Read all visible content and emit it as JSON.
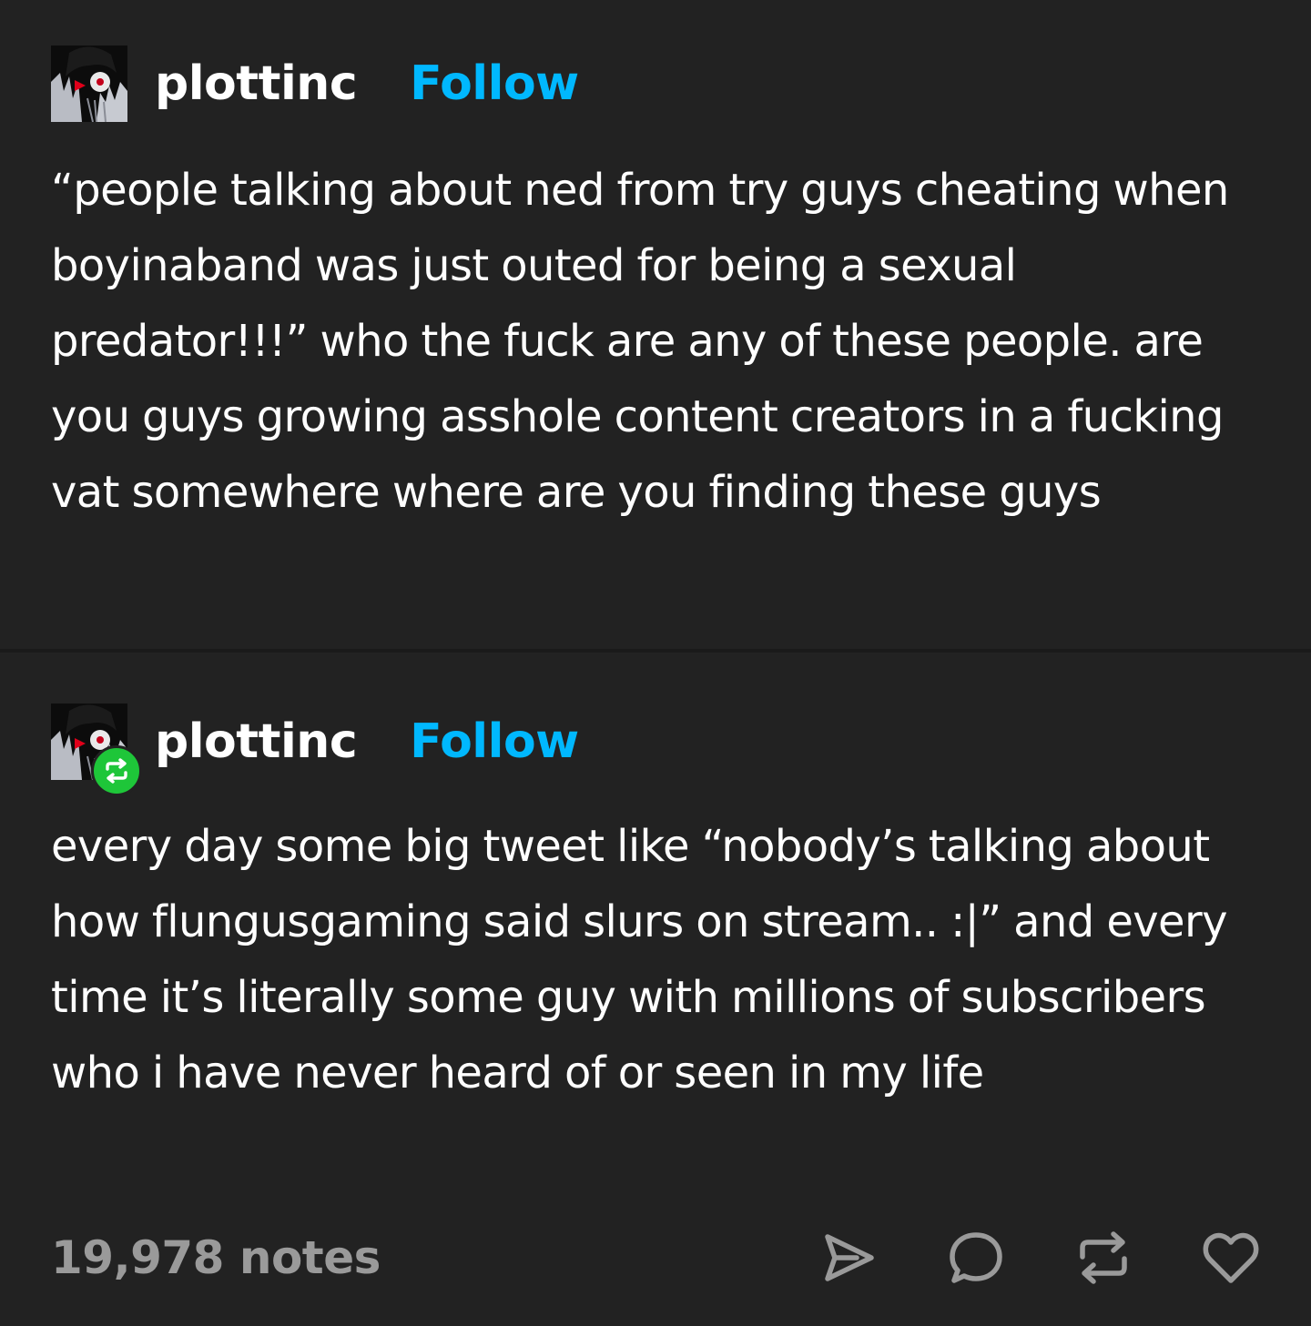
{
  "posts": [
    {
      "username": "plottinc",
      "follow_label": "Follow",
      "avatar_icon": "avatar-icon",
      "text": "“people talking about ned from try guys cheating when boyinaband was just outed for being a sexual predator!!!” who the fuck are any of these people. are you guys growing asshole content creators in a fucking vat somewhere where are you finding these guys"
    },
    {
      "username": "plottinc",
      "follow_label": "Follow",
      "avatar_icon": "avatar-icon",
      "badge_icon": "reblog-badge-icon",
      "text": "every day some big tweet like “nobody’s talking about how flungusgaming said slurs on stream.. :|” and every time it’s literally some guy with millions of subscribers who i have never heard of or seen in my life"
    }
  ],
  "footer": {
    "notes": "19,978 notes",
    "actions": [
      "share-icon",
      "reply-icon",
      "reblog-icon",
      "like-icon"
    ]
  },
  "colors": {
    "background": "#222222",
    "text": "#ffffff",
    "follow": "#00b8ff",
    "notes": "#9a9a9a",
    "reblog_badge": "#1ec639"
  }
}
